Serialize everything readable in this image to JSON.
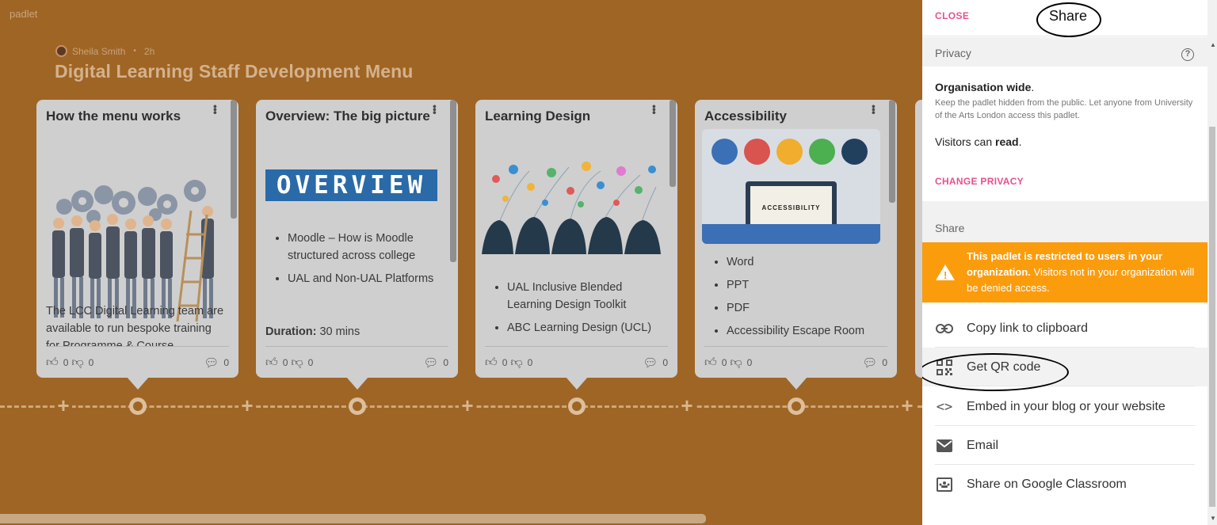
{
  "board": {
    "logo": "padlet",
    "author": "Sheila Smith",
    "time_ago": "2h",
    "title": "Digital Learning Staff Development Menu",
    "cards": [
      {
        "title": "How the menu works",
        "body": "The LCC Digital Learning team are available to run bespoke training for Programme & Course",
        "likes": "0",
        "dislikes": "0",
        "comments": "0"
      },
      {
        "title": "Overview: The big picture",
        "image_text": "OVERVIEW",
        "list": [
          "Moodle – How is Moodle structured across college",
          "UAL and Non-UAL Platforms"
        ],
        "duration_label": "Duration:",
        "duration_value": "30 mins",
        "likes": "0",
        "dislikes": "0",
        "comments": "0"
      },
      {
        "title": "Learning Design",
        "list": [
          "UAL Inclusive Blended Learning Design Toolkit",
          "ABC Learning Design (UCL)"
        ],
        "likes": "0",
        "dislikes": "0",
        "comments": "0"
      },
      {
        "title": "Accessibility",
        "image_text": "ACCESSIBILITY",
        "list": [
          "Word",
          "PPT",
          "PDF",
          "Accessibility Escape Room"
        ],
        "likes": "0",
        "dislikes": "0",
        "comments": "0"
      }
    ]
  },
  "share_panel": {
    "close_label": "CLOSE",
    "heading": "Share",
    "privacy_section": "Privacy",
    "privacy_title": "Organisation wide",
    "privacy_desc": "Keep the padlet hidden from the public. Let anyone from University of the Arts London access this padlet.",
    "visitors_prefix": "Visitors can",
    "visitors_value": "read",
    "change_privacy": "CHANGE PRIVACY",
    "share_section": "Share",
    "warning_bold": "This padlet is restricted to users in your organization.",
    "warning_rest": "Visitors not in your organization will be denied access.",
    "items": [
      {
        "label": "Copy link to clipboard",
        "icon": "link-icon"
      },
      {
        "label": "Get QR code",
        "icon": "qr-code-icon"
      },
      {
        "label": "Embed in your blog or your website",
        "icon": "code-icon"
      },
      {
        "label": "Email",
        "icon": "email-icon"
      },
      {
        "label": "Share on Google Classroom",
        "icon": "google-classroom-icon"
      }
    ]
  },
  "colors": {
    "board_bg": "#9f6525",
    "accent_pink": "#e8508e",
    "warning_orange": "#fb9c0d"
  }
}
